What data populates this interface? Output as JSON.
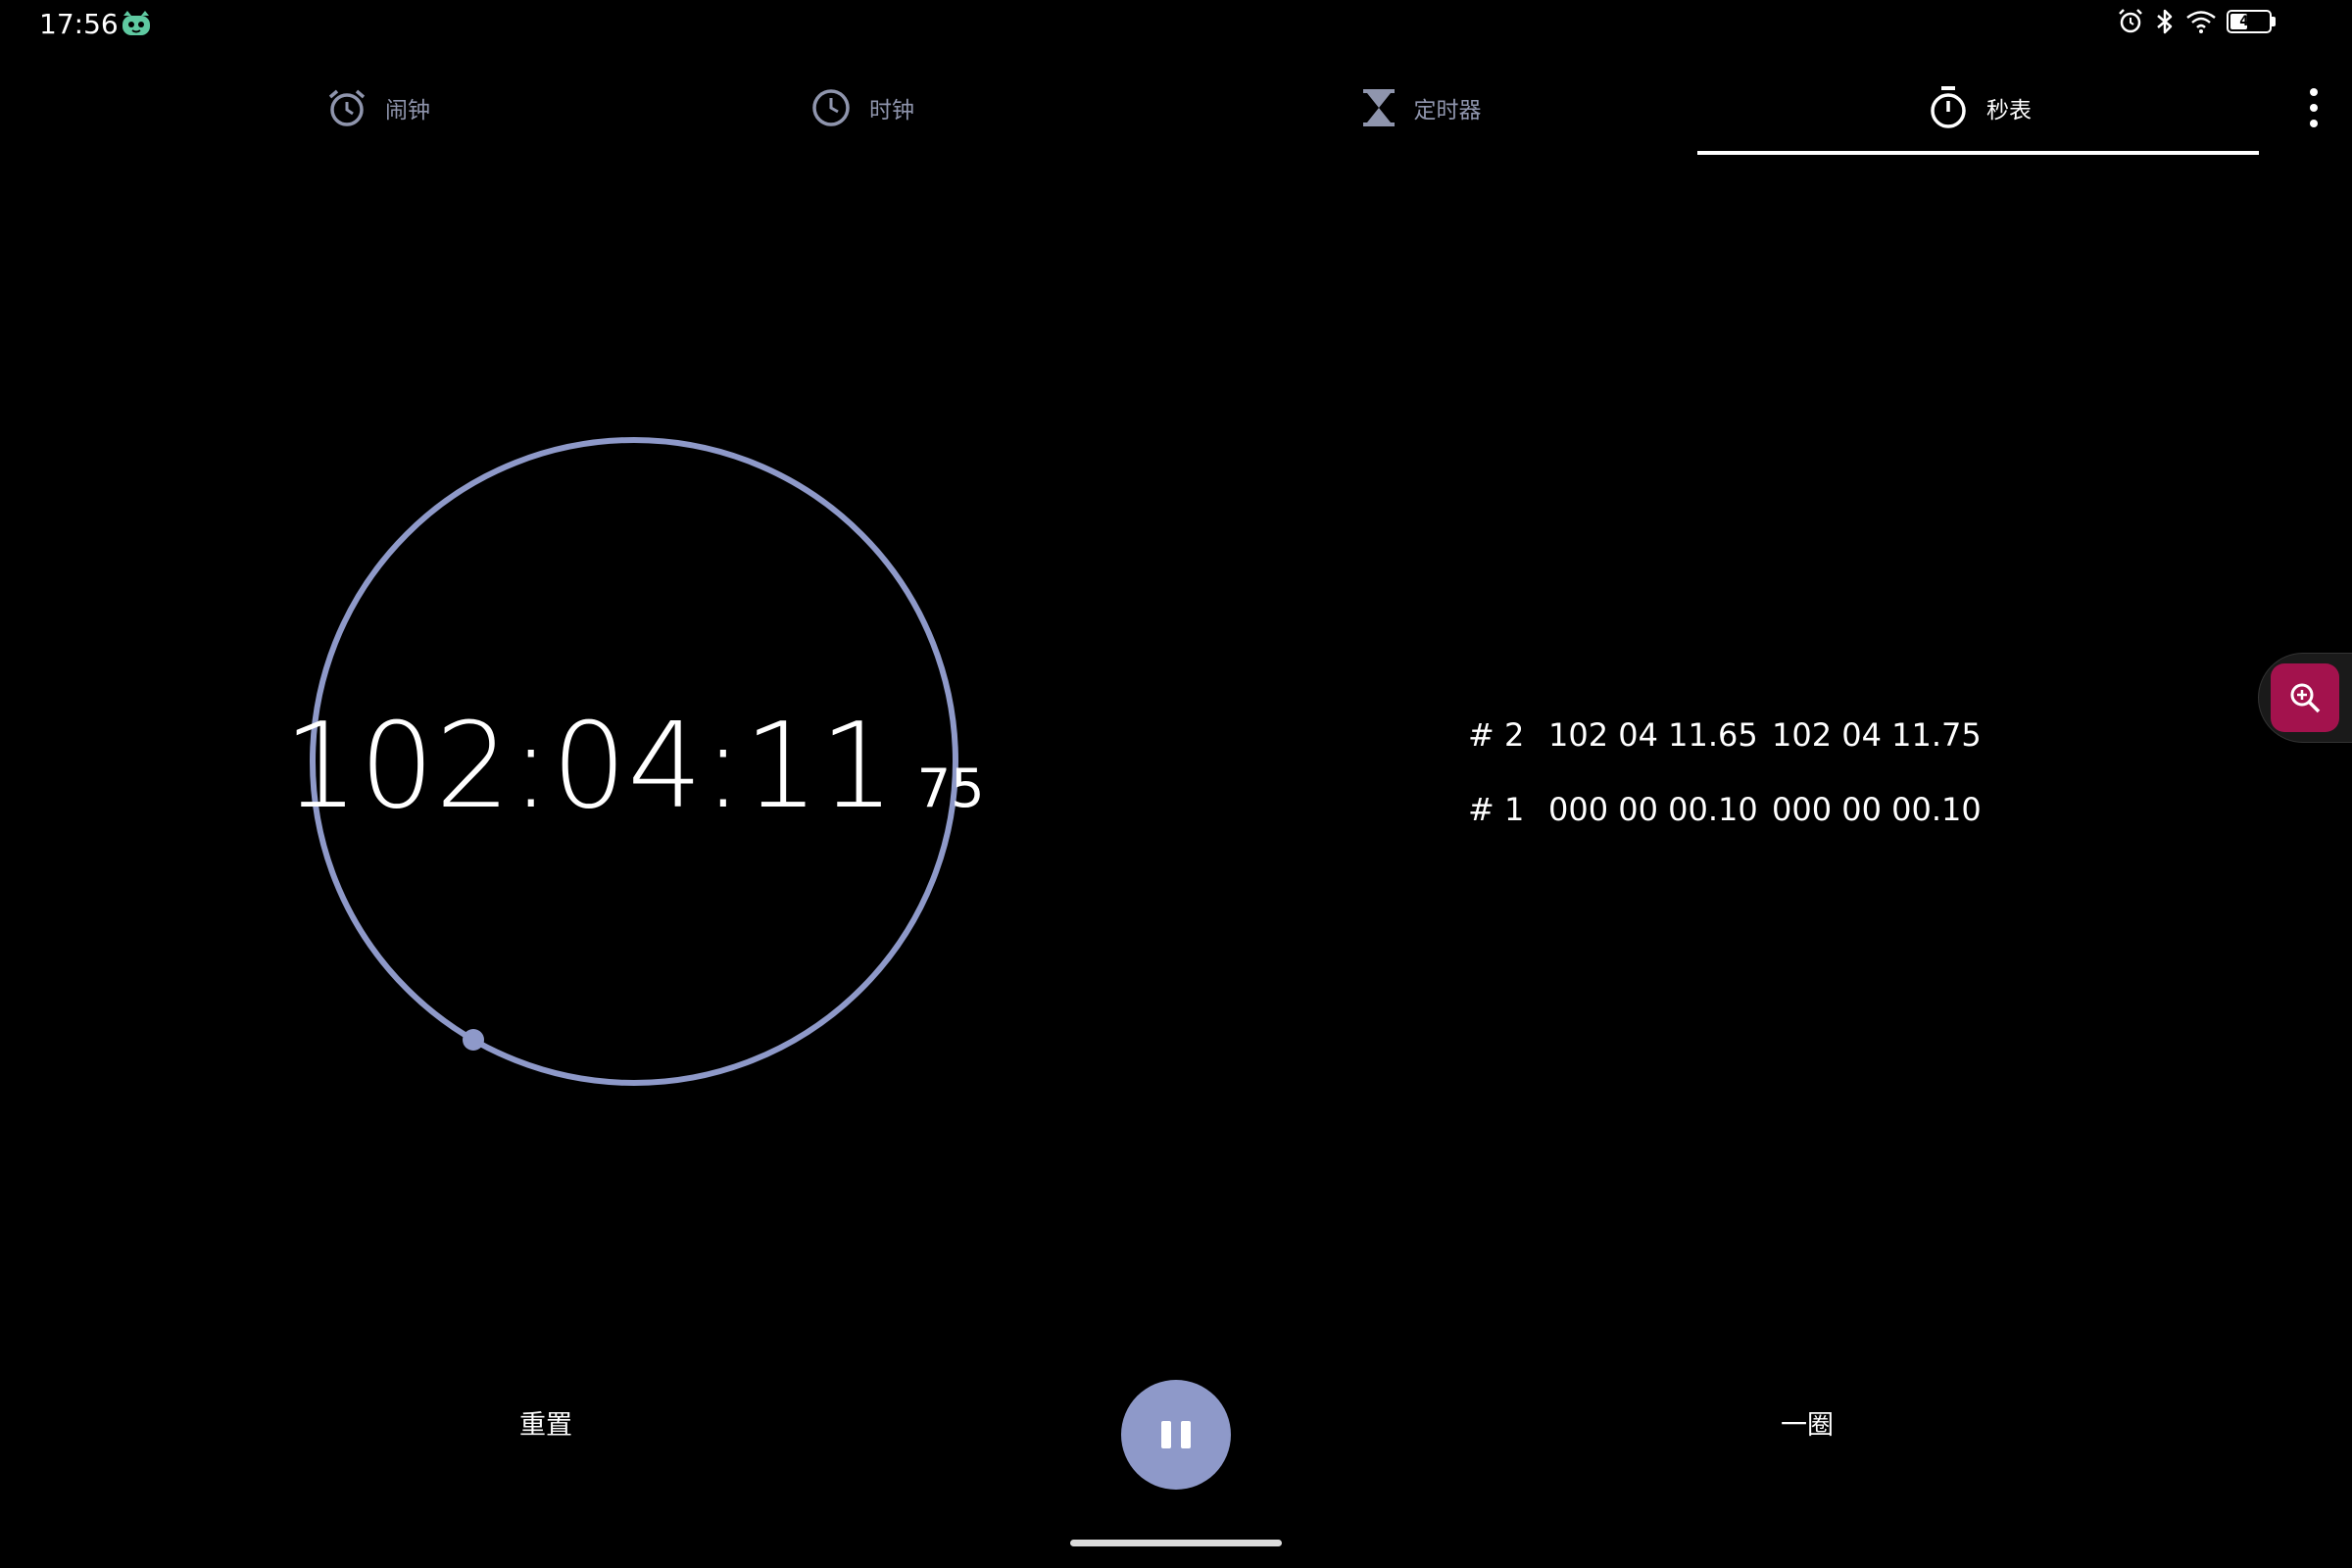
{
  "status_bar": {
    "time": "17:56",
    "battery_level": "46",
    "battery_fraction": 0.46,
    "icons": [
      "app-mascot-icon",
      "alarm-icon",
      "bluetooth-icon",
      "wifi-icon",
      "battery-icon"
    ]
  },
  "tabs": [
    {
      "label": "闹钟",
      "icon": "alarm-clock-icon",
      "active": false
    },
    {
      "label": "时钟",
      "icon": "clock-icon",
      "active": false
    },
    {
      "label": "定时器",
      "icon": "hourglass-icon",
      "active": false
    },
    {
      "label": "秒表",
      "icon": "stopwatch-icon",
      "active": true
    }
  ],
  "stopwatch": {
    "main_time": "102:04:11",
    "hundredths": "75"
  },
  "laps": [
    {
      "num": "# 2",
      "lap_time": "102 04 11.65",
      "total": "102 04 11.75"
    },
    {
      "num": "# 1",
      "lap_time": "000 00 00.10",
      "total": "000 00 00.10"
    }
  ],
  "controls": {
    "reset_label": "重置",
    "lap_label": "一圈",
    "pause_icon": "pause-icon"
  },
  "colors": {
    "accent": "#8e99c9",
    "ring": "#8e99c9",
    "magnifier": "#a3124d",
    "inactive_tab": "#8f95ad"
  }
}
